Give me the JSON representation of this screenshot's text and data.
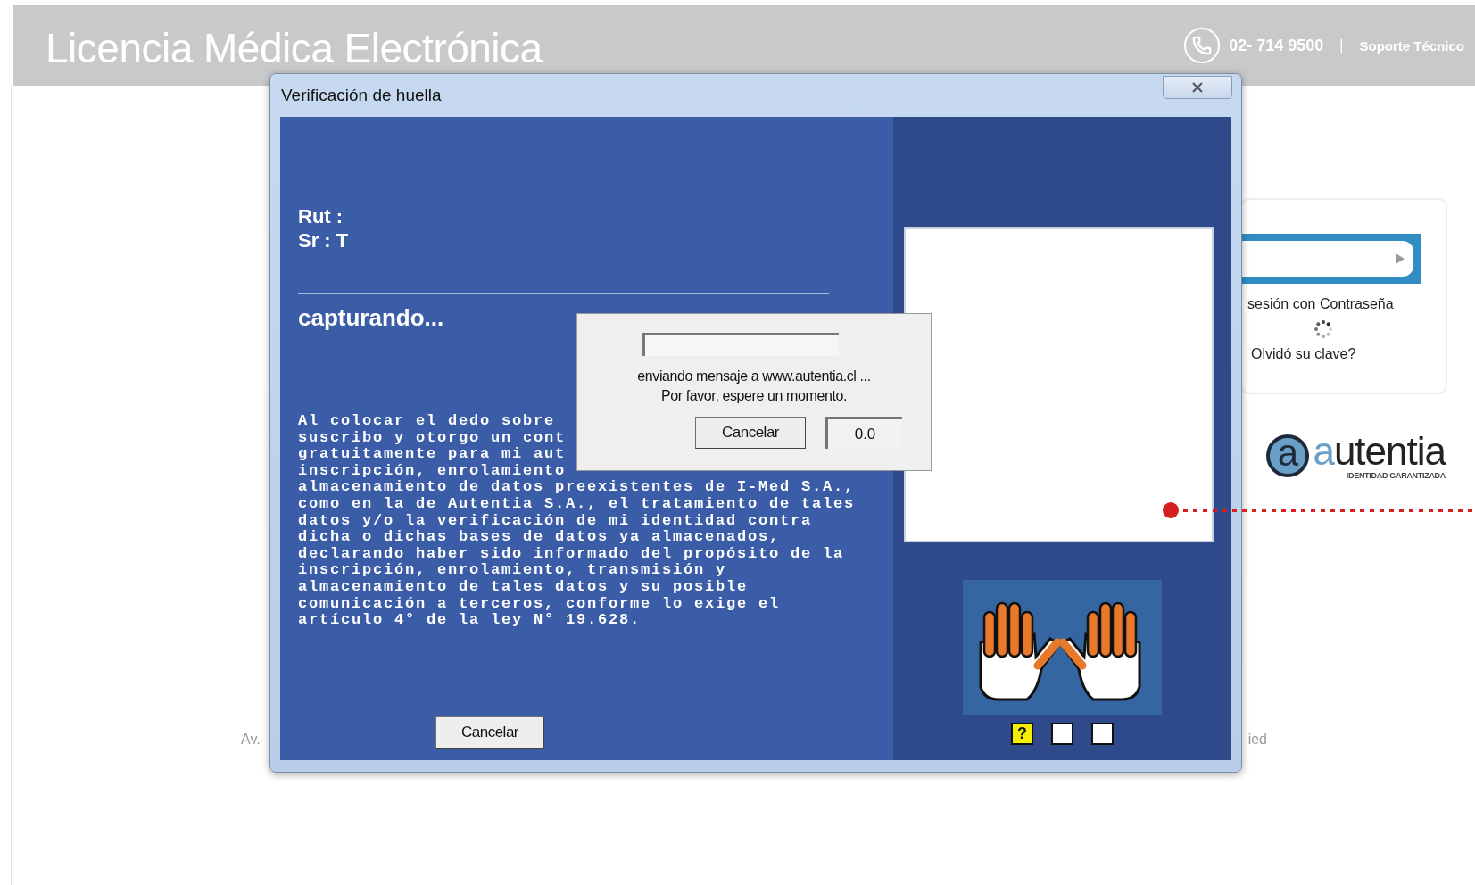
{
  "header": {
    "title": "Licencia Médica Electrónica",
    "phone": "02- 714 9500",
    "separator": "|",
    "support_link": "Soporte Técnico"
  },
  "login_card": {
    "password_link": "sesión con Contraseña",
    "forgot_link": "Olvidó su clave?"
  },
  "logo": {
    "wordmark": "autentia",
    "mark": "a",
    "tagline": "IDENTIDAD GARANTIZADA"
  },
  "footer": {
    "left": "Av.",
    "right": "ied"
  },
  "dialog": {
    "title": "Verificación de huella",
    "rut_label": "Rut :",
    "name_label": "Sr : T",
    "status": "capturando...",
    "consent_partial_lines": [
      "Al colocar el dedo sobre",
      "suscribo y otorgo un cont",
      "gratuitamente para mi aut",
      "inscripción, enrolamiento"
    ],
    "consent_lines": [
      "almacenamiento de datos preexistentes de I-Med S.A.,",
      "como en la de Autentia S.A., el tratamiento de tales",
      "datos y/o la verificación de mi identidad contra",
      "dicha o dichas bases de datos ya almacenados,",
      "declarando haber sido informado del propósito de la",
      "inscripción, enrolamiento, transmisión y",
      "almacenamiento de tales datos y su posible",
      "comunicación a terceros, conforme lo exige el",
      "artículo 4° de la ley N° 19.628."
    ],
    "cancel_button": "Cancelar",
    "finger_slots": [
      {
        "kind": "current",
        "label": "?"
      },
      {
        "kind": "empty"
      },
      {
        "kind": "empty"
      }
    ]
  },
  "progress_dialog": {
    "level": 0,
    "message": "enviando mensaje a www.autentia.cl ...",
    "wait": "Por favor, espere un momento.",
    "cancel_button": "Cancelar",
    "timer": "0.0"
  }
}
